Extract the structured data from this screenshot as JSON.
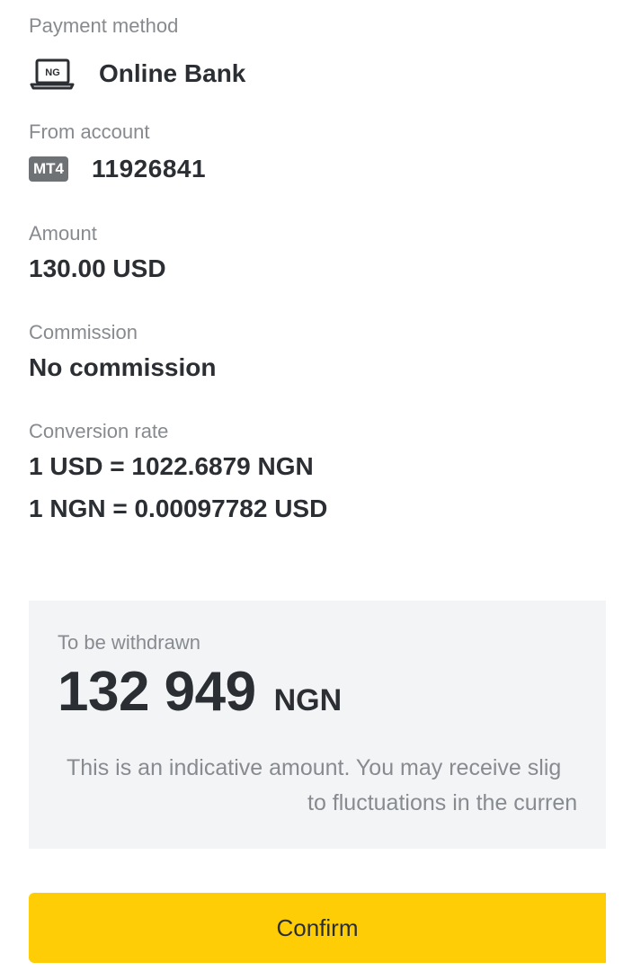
{
  "payment_method": {
    "label": "Payment method",
    "icon": "laptop-ng-icon",
    "icon_text": "NG",
    "value": "Online Bank"
  },
  "from_account": {
    "label": "From account",
    "badge": "MT4",
    "value": "11926841"
  },
  "amount": {
    "label": "Amount",
    "value": "130.00 USD"
  },
  "commission": {
    "label": "Commission",
    "value": "No commission"
  },
  "conversion_rate": {
    "label": "Conversion rate",
    "line1": "1 USD = 1022.6879 NGN",
    "line2": "1 NGN = 0.00097782 USD"
  },
  "summary": {
    "label": "To be withdrawn",
    "amount": "132 949",
    "currency": "NGN",
    "note_line1": "This is an indicative amount. You may receive slig",
    "note_line2": "to fluctuations in the curren"
  },
  "confirm_label": "Confirm",
  "colors": {
    "accent": "#fecd05",
    "text_primary": "#2b2f33",
    "text_secondary": "#878b8f",
    "badge_bg": "#6e7275",
    "summary_bg": "#f3f4f6"
  }
}
